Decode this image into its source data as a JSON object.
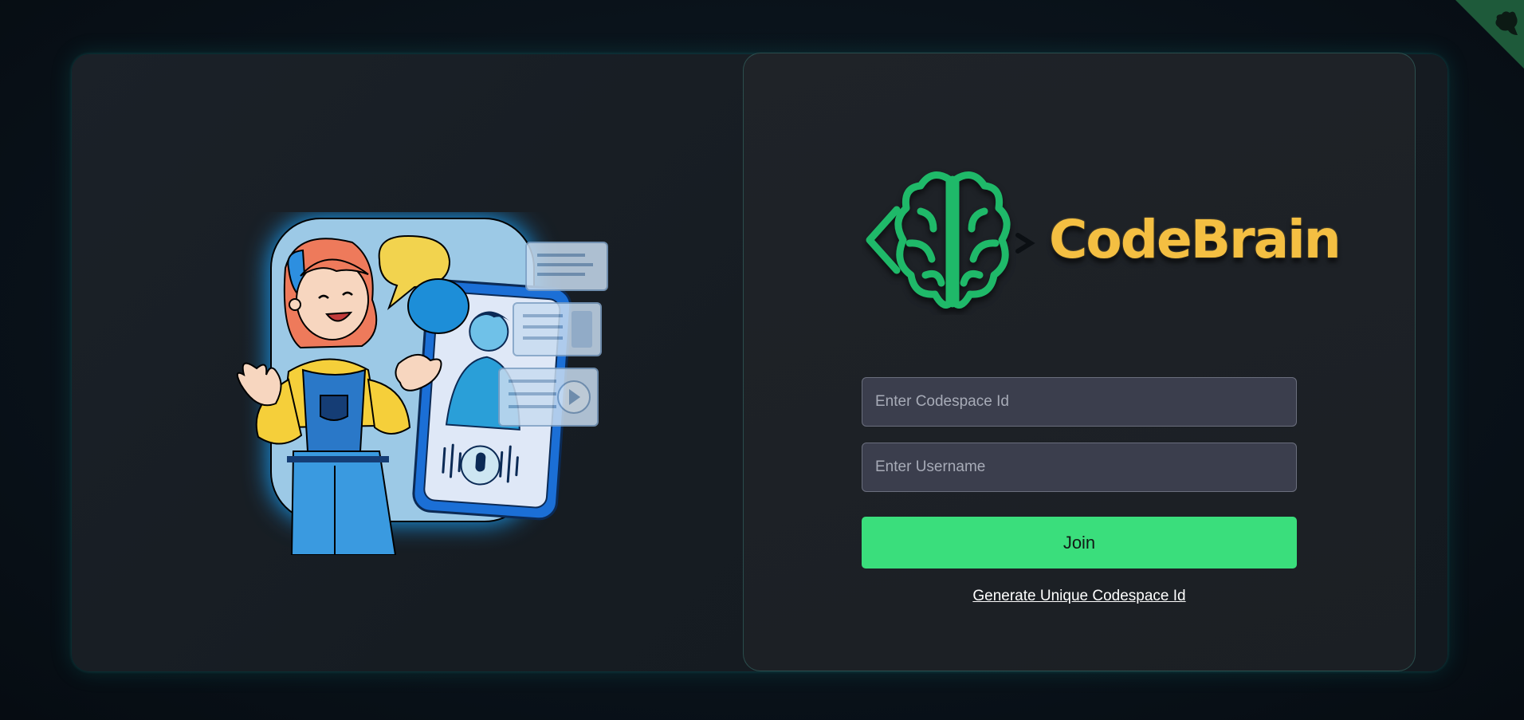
{
  "illustration": {
    "icon": "video-chat-illustration"
  },
  "logo": {
    "icon": "brain-code-icon",
    "text": "CodeBrain",
    "color": "#f4bf42",
    "mark_color": "#1fb969"
  },
  "form": {
    "codespace_placeholder": "Enter Codespace Id",
    "codespace_value": "",
    "username_placeholder": "Enter Username",
    "username_value": "",
    "join_label": "Join",
    "generate_label": "Generate Unique Codespace Id"
  },
  "github_corner": {
    "icon": "github-octocat-icon",
    "color": "#1e5a3a"
  },
  "colors": {
    "accent": "#3ade7c",
    "background": "#0a131b",
    "panel": "#1d2126"
  }
}
